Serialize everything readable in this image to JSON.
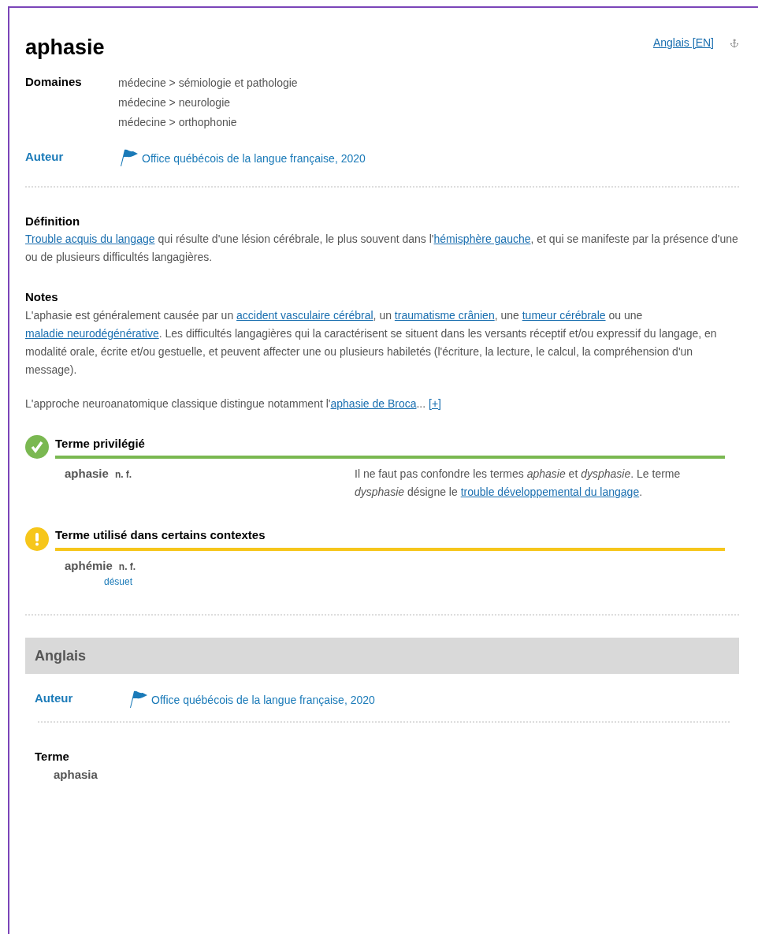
{
  "entry": {
    "title": "aphasie",
    "language_link": "Anglais [EN]"
  },
  "domains": {
    "label": "Domaines",
    "items": [
      "médecine > sémiologie et pathologie",
      "médecine > neurologie",
      "médecine > orthophonie"
    ]
  },
  "author": {
    "label": "Auteur",
    "text": "Office québécois de la langue française, 2020"
  },
  "definition": {
    "label": "Définition",
    "segments": [
      {
        "text": "Trouble acquis du langage",
        "link": true
      },
      {
        "text": " qui résulte d'une lésion cérébrale, le plus souvent dans l'",
        "link": false
      },
      {
        "text": "hémisphère gauche",
        "link": true
      },
      {
        "text": ", et qui se manifeste par la présence d'une ou de plusieurs difficultés langagières.",
        "link": false
      }
    ]
  },
  "notes": {
    "label": "Notes",
    "paragraphs": [
      [
        {
          "text": "L'aphasie est généralement causée par un ",
          "link": false
        },
        {
          "text": "accident vasculaire cérébral",
          "link": true
        },
        {
          "text": ", un ",
          "link": false
        },
        {
          "text": "traumatisme crânien",
          "link": true
        },
        {
          "text": ", une ",
          "link": false
        },
        {
          "text": "tumeur cérébrale",
          "link": true
        },
        {
          "text": " ou une ",
          "link": false
        },
        {
          "text": "maladie neurodégénérative",
          "link": true
        },
        {
          "text": ". Les difficultés langagières qui la caractérisent se situent dans les versants réceptif et/ou expressif du langage, en modalité orale, écrite et/ou gestuelle, et peuvent affecter une ou plusieurs habiletés (l'écriture, la lecture, le calcul, la compréhension d'un message).",
          "link": false
        }
      ],
      [
        {
          "text": "L'approche neuroanatomique classique distingue notamment l'",
          "link": false
        },
        {
          "text": "aphasie de Broca",
          "link": true
        },
        {
          "text": "...  ",
          "link": false
        },
        {
          "text": "[+]",
          "link": true
        }
      ]
    ]
  },
  "terms": [
    {
      "kind": "preferred",
      "heading": "Terme privilégié",
      "term": "aphasie",
      "category": "n. f.",
      "note": [
        {
          "text": "Il ne faut pas confondre les termes *aphasie* et *dysphasie*. Le terme *dysphasie* désigne le ",
          "link": false
        },
        {
          "text": "trouble développemental du langage",
          "link": true
        },
        {
          "text": ".",
          "link": false
        }
      ]
    },
    {
      "kind": "contextual",
      "heading": "Terme utilisé dans certains contextes",
      "term": "aphémie",
      "category": "n. f.",
      "qualifier": "désuet"
    }
  ],
  "english": {
    "heading": "Anglais",
    "author": {
      "label": "Auteur",
      "text": "Office québécois de la langue française, 2020"
    },
    "term_label": "Terme",
    "term": "aphasia"
  }
}
